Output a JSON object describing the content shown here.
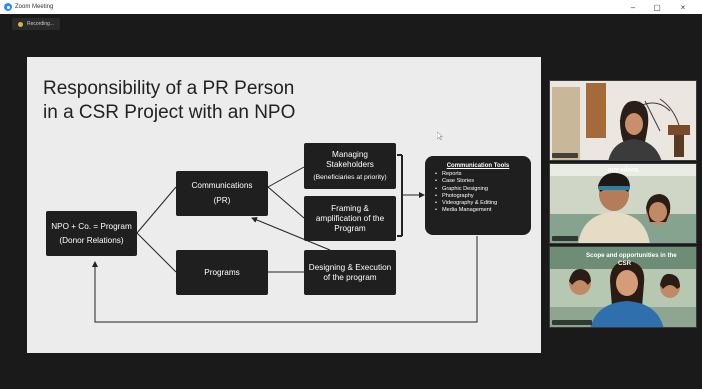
{
  "window": {
    "title": "Zoom Meeting",
    "minimize": "–",
    "maximize": "▢",
    "close": "×"
  },
  "recording": {
    "label": "Recording..."
  },
  "slide": {
    "title_line1": "Responsibility of a PR Person",
    "title_line2": "in a CSR Project with an NPO",
    "nodes": {
      "npo_line1": "NPO + Co. = Program",
      "npo_line2": "(Donor Relations)",
      "comm_line1": "Communications",
      "comm_line2": "(PR)",
      "programs": "Programs",
      "managing_line1": "Managing",
      "managing_line2": "Stakeholders",
      "managing_line3": "(Beneficiaries at priority)",
      "framing_line1": "Framing &",
      "framing_line2": "amplification of the",
      "framing_line3": "Program",
      "designing_line1": "Designing & Execution",
      "designing_line2": "of the program"
    },
    "comm_tools": {
      "title": "Communication Tools",
      "items": [
        "Reports",
        "Case Stories",
        "Graphic Designing",
        "Photography",
        "Videography & Editing",
        "Media Management"
      ]
    }
  },
  "participants": {
    "tile2_banner": "Scope and",
    "tile3_banner_line1": "Scope and opportunities in the",
    "tile3_banner_line2": "CSR"
  },
  "colors": {
    "background": "#1a1a1a",
    "slide": "#ececec",
    "box": "#1f1f1f",
    "zoom_blue": "#2d8cff"
  },
  "icons": {
    "app": "zoom-icon",
    "recording": "recording-dot-icon",
    "cursor": "mouse-pointer-icon"
  }
}
